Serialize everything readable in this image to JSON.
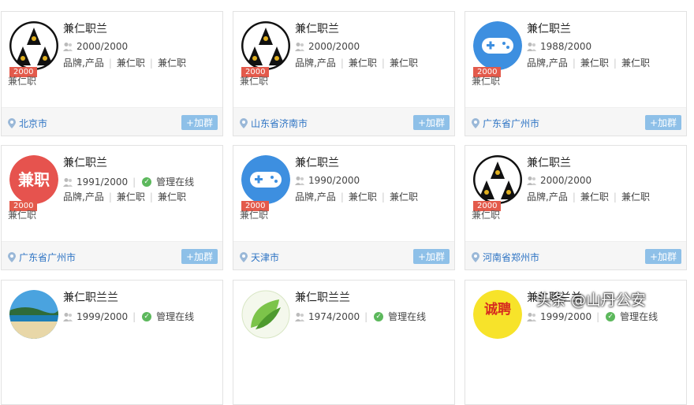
{
  "cards": [
    {
      "name": "兼仁职兰",
      "count": "2000/2000",
      "online": "",
      "tags": [
        "品牌,产品",
        "兼仁职",
        "兼仁职"
      ],
      "desc": "兼仁职",
      "location": "北京市",
      "join_label": "+加群",
      "badge": "2000",
      "avatar": "aaa-logo"
    },
    {
      "name": "兼仁职兰",
      "count": "2000/2000",
      "online": "",
      "tags": [
        "品牌,产品",
        "兼仁职",
        "兼仁职"
      ],
      "desc": "兼仁职",
      "location": "山东省济南市",
      "join_label": "+加群",
      "badge": "2000",
      "avatar": "aaa-logo"
    },
    {
      "name": "兼仁职兰",
      "count": "1988/2000",
      "online": "",
      "tags": [
        "品牌,产品",
        "兼仁职",
        "兼仁职"
      ],
      "desc": "兼仁职",
      "location": "广东省广州市",
      "join_label": "+加群",
      "badge": "2000",
      "avatar": "gamepad-icon"
    },
    {
      "name": "兼仁职兰",
      "count": "1991/2000",
      "online": "管理在线",
      "tags": [
        "品牌,产品",
        "兼仁职",
        "兼仁职"
      ],
      "desc": "兼仁职",
      "location": "广东省广州市",
      "join_label": "+加群",
      "badge": "2000",
      "avatar": "jianzhi-red",
      "avatar_text": "兼职"
    },
    {
      "name": "兼仁职兰",
      "count": "1990/2000",
      "online": "",
      "tags": [
        "品牌,产品",
        "兼仁职",
        "兼仁职"
      ],
      "desc": "兼仁职",
      "location": "天津市",
      "join_label": "+加群",
      "badge": "2000",
      "avatar": "gamepad-icon"
    },
    {
      "name": "兼仁职兰",
      "count": "2000/2000",
      "online": "",
      "tags": [
        "品牌,产品",
        "兼仁职",
        "兼仁职"
      ],
      "desc": "兼仁职",
      "location": "河南省郑州市",
      "join_label": "+加群",
      "badge": "2000",
      "avatar": "aaa-logo"
    },
    {
      "name": "兼仁职兰兰",
      "count": "1999/2000",
      "online": "管理在线",
      "avatar": "beach-photo"
    },
    {
      "name": "兼仁职兰兰",
      "count": "1974/2000",
      "online": "管理在线",
      "avatar": "leaf-logo"
    },
    {
      "name": "兼仁职兰兰",
      "count": "1999/2000",
      "online": "管理在线",
      "avatar": "chengpin-yellow",
      "avatar_text": "诚聘"
    }
  ],
  "colors": {
    "link": "#2e74c4",
    "badge": "#e35a4b",
    "join": "#8ec0e8",
    "online": "#5cb85c"
  },
  "watermark": "头条 @山丹公安"
}
